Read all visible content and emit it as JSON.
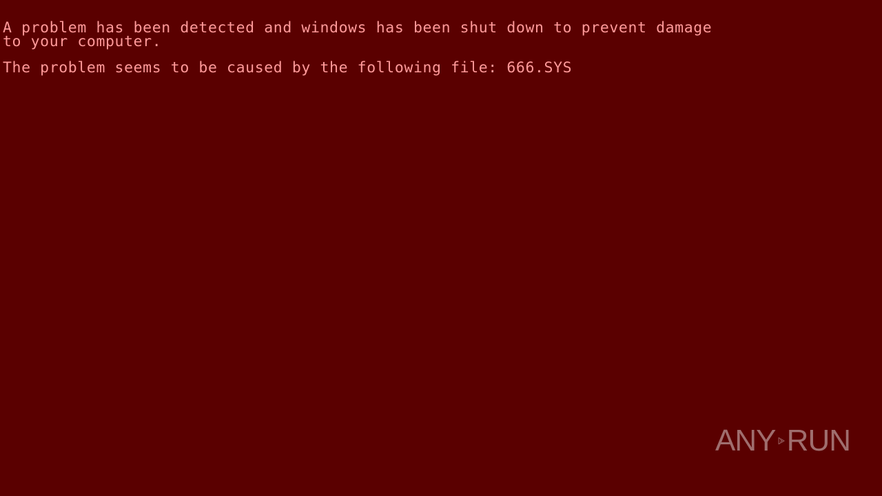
{
  "bsod": {
    "line1": "A problem has been detected and windows has been shut down to prevent damage",
    "line2": "to your computer.",
    "line3": "The problem seems to be caused by the following file: 666.SYS"
  },
  "watermark": {
    "left_text": "ANY",
    "right_text": "RUN",
    "icon": "play-triangle-icon"
  },
  "colors": {
    "background": "#5a0000",
    "text": "#ff9a9a"
  }
}
